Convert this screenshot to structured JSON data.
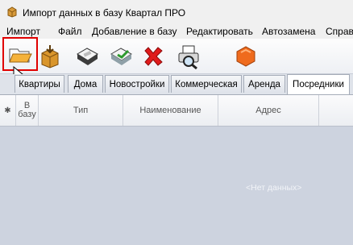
{
  "window": {
    "title": "Импорт данных в базу Квартал ПРО",
    "app_icon": "package-icon"
  },
  "menu": [
    "Импорт",
    "Файл",
    "Добавление в базу",
    "Редактировать",
    "Автозамена",
    "Справ"
  ],
  "toolbar": {
    "buttons": [
      {
        "name": "open-folder-icon",
        "selected": true
      },
      {
        "name": "import-box-icon",
        "selected": false
      },
      {
        "name": "save-disk-icon",
        "selected": false
      },
      {
        "name": "save-green-icon",
        "selected": false
      },
      {
        "name": "delete-x-icon",
        "selected": false
      },
      {
        "name": "print-preview-icon",
        "selected": false
      },
      {
        "name": "stop-hexagon-icon",
        "selected": false
      }
    ],
    "highlight_color": "#e00000"
  },
  "tabs": {
    "items": [
      "Квартиры",
      "Дома",
      "Новостройки",
      "Коммерческая",
      "Аренда",
      "Посредники"
    ],
    "active": "Посредники"
  },
  "grid": {
    "columns": [
      "✱",
      "В базу",
      "Тип",
      "Наименование",
      "Адрес"
    ],
    "empty_text": "<Нет данных>"
  }
}
